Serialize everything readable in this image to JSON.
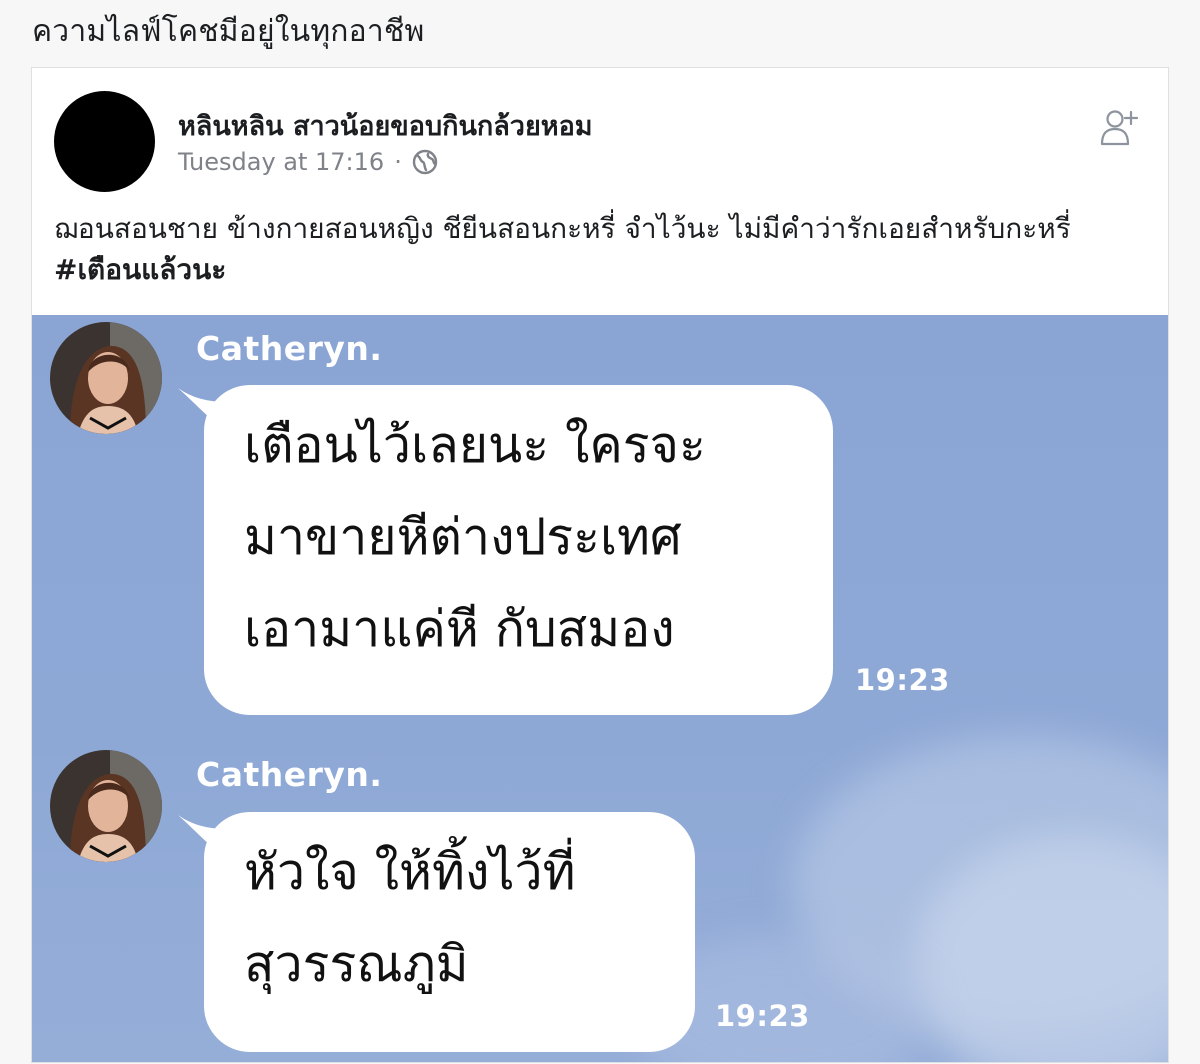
{
  "caption": "ความไลฟ์โคชมีอยู่ในทุกอาชีพ",
  "post": {
    "author": "หลินหลิน สาวน้อยขอบกินกล้วยหอม",
    "timestamp": "Tuesday at 17:16",
    "separator": "·",
    "privacy_icon": "globe-icon",
    "add_friend_icon": "add-friend-icon",
    "text": "ฌอนสอนชาย ข้างกายสอนหญิง ชียีนสอนกะหรี่ จำไว้นะ ไม่มีคำว่ารักเอยสำหรับกะหรี่ ",
    "hashtag": "#เตือนแล้วนะ"
  },
  "chat": {
    "messages": [
      {
        "sender": "Catheryn.",
        "lines": [
          "เตือนไว้เลยนะ ใครจะ",
          "มาขายหีต่างประเทศ",
          "เอามาแค่หี กับสมอง"
        ],
        "time": "19:23"
      },
      {
        "sender": "Catheryn.",
        "lines": [
          "หัวใจ ให้ทิ้งไว้ที่",
          "สุวรรณภูมิ"
        ],
        "time": "19:23"
      }
    ]
  },
  "colors": {
    "chat_background": "#8ea8d6",
    "bubble": "#ffffff",
    "text_primary": "#1c1e21",
    "text_secondary": "#7f8288"
  }
}
